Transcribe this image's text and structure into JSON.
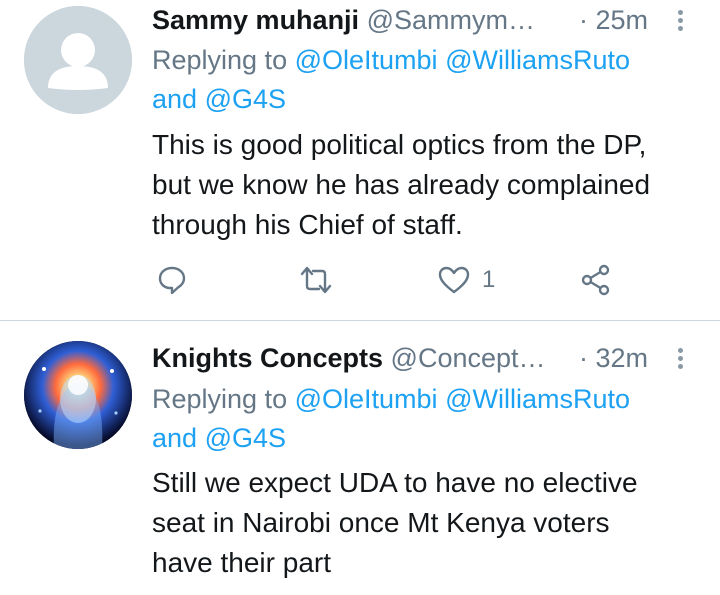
{
  "tweets": [
    {
      "display_name": "Sammy muhanji",
      "handle": "@Sammym…",
      "time": "· 25m",
      "replying_prefix": "Replying to",
      "mentions": [
        "@OleItumbi",
        "@WilliamsRuto",
        "@G4S"
      ],
      "and_word": "and",
      "lines": [
        "This is good political optics from the DP,",
        "but we know he has already complained",
        "through his Chief of staff."
      ],
      "like_count": "1"
    },
    {
      "display_name": "Knights Concepts",
      "handle": "@Concept…",
      "time": "· 32m",
      "replying_prefix": "Replying to",
      "mentions": [
        "@OleItumbi",
        "@WilliamsRuto",
        "@G4S"
      ],
      "and_word": "and",
      "lines": [
        "Still we expect UDA to have no elective",
        "seat in Nairobi once Mt Kenya voters",
        "have their part"
      ]
    }
  ],
  "icons": {
    "reply": "reply-icon",
    "retweet": "retweet-icon",
    "like": "like-icon",
    "share": "share-icon",
    "more": "more-vertical-icon"
  },
  "colors": {
    "link": "#1da1f2",
    "secondary_text": "#657786",
    "divider": "#ccd6dd",
    "icon": "#657786"
  }
}
